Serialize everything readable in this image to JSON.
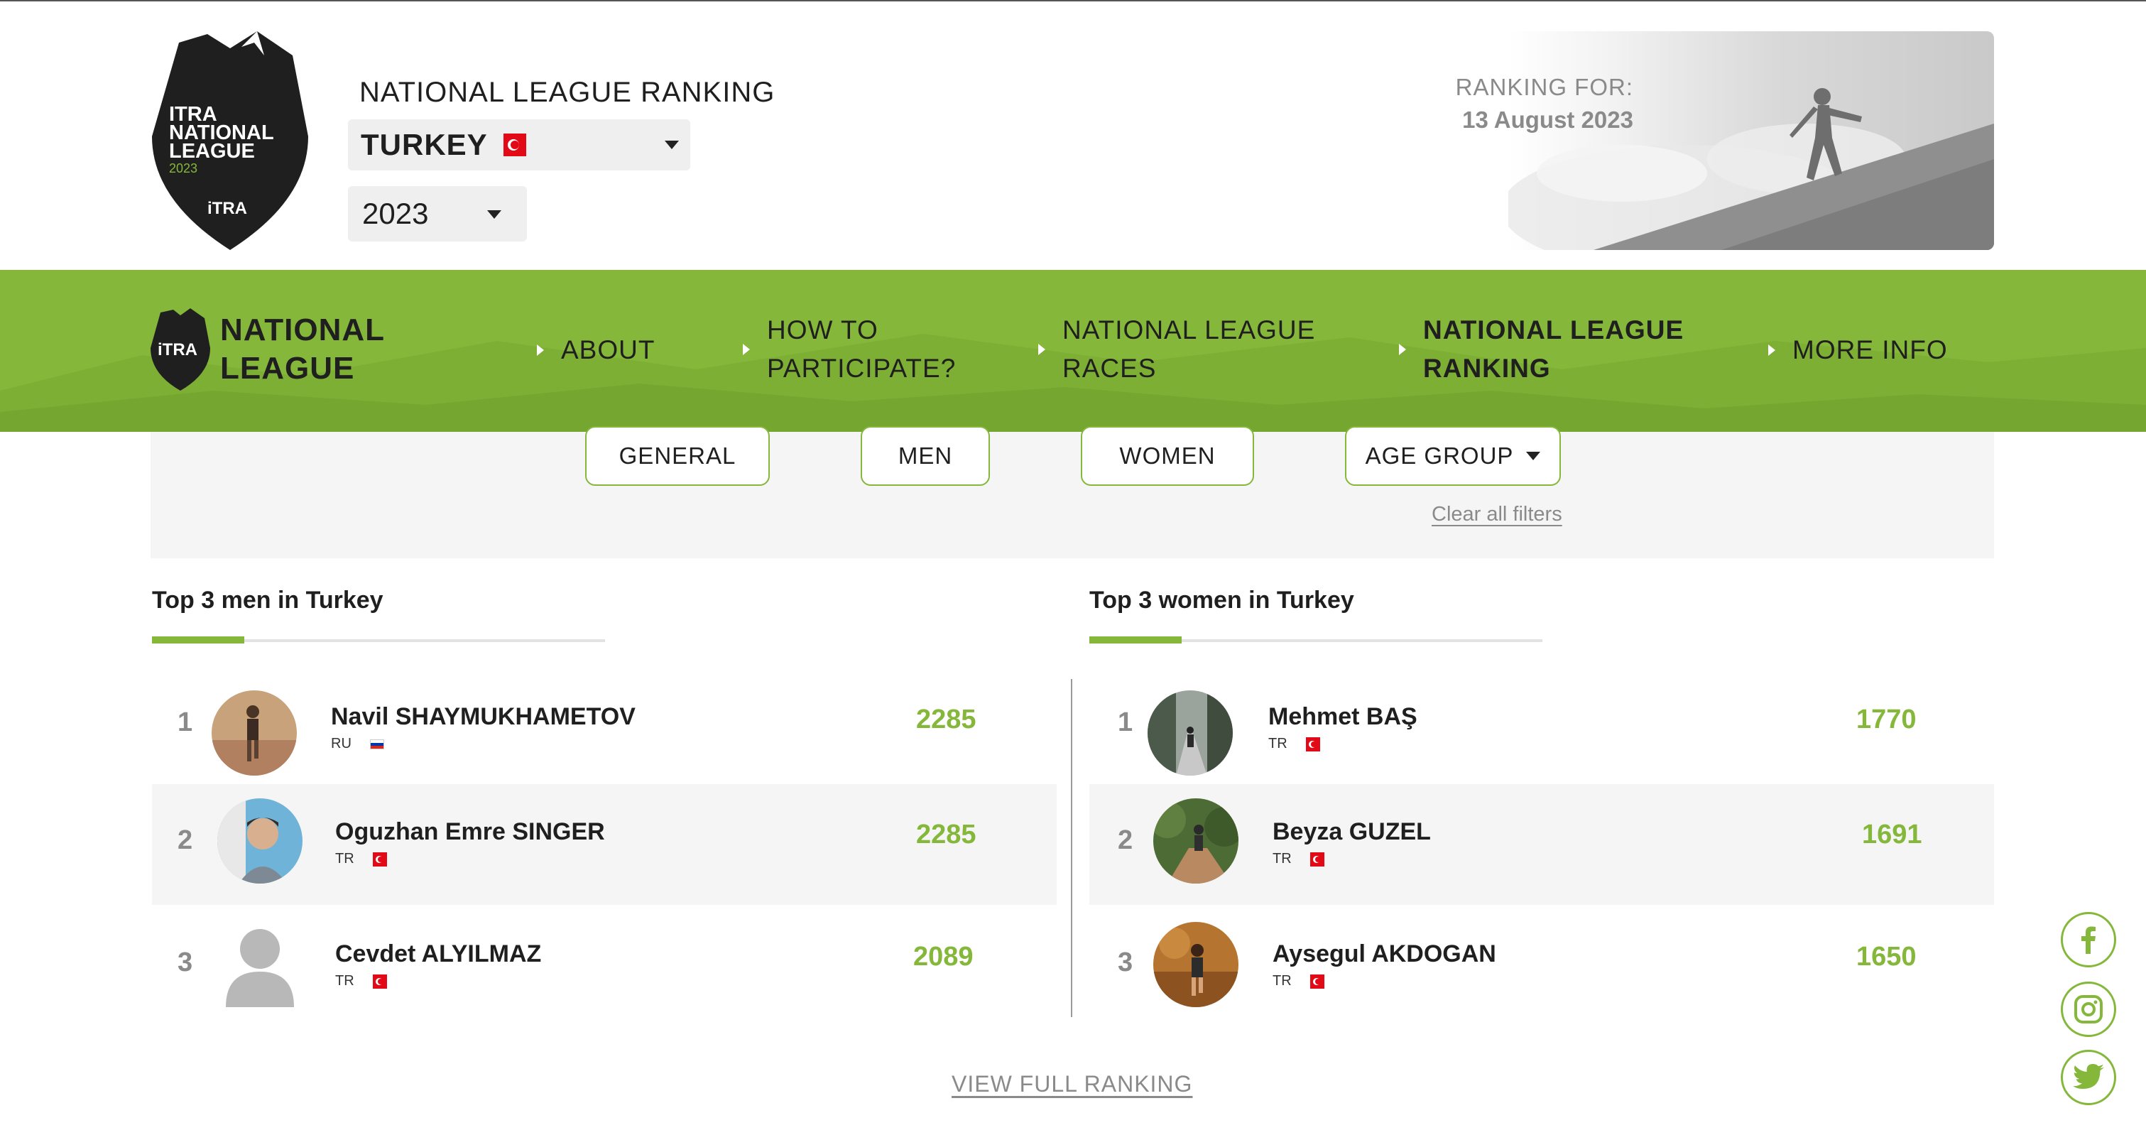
{
  "header": {
    "badge": {
      "line1": "ITRA",
      "line2": "NATIONAL",
      "line3": "LEAGUE",
      "year": "2023",
      "brand": "iTRA"
    },
    "title": "NATIONAL LEAGUE RANKING",
    "country_select": {
      "value": "TURKEY",
      "flag_icon": "turkey-flag-icon"
    },
    "year_select": {
      "value": "2023"
    },
    "ranking_for_label": "RANKING FOR:",
    "ranking_date": "13 August 2023"
  },
  "nav": {
    "logo": {
      "brand": "iTRA",
      "line1": "NATIONAL",
      "line2": "LEAGUE"
    },
    "items": [
      {
        "line1": "ABOUT",
        "line2": ""
      },
      {
        "line1": "HOW TO",
        "line2": "PARTICIPATE?"
      },
      {
        "line1": "NATIONAL LEAGUE",
        "line2": "RACES"
      },
      {
        "line1": "NATIONAL LEAGUE",
        "line2": "RANKING"
      },
      {
        "line1": "MORE INFO",
        "line2": ""
      }
    ],
    "active_index": 3
  },
  "filters": {
    "chips": [
      "GENERAL",
      "MEN",
      "WOMEN",
      "AGE GROUP"
    ],
    "clear_label": "Clear all filters"
  },
  "men": {
    "title": "Top 3 men in Turkey",
    "rows": [
      {
        "rank": "1",
        "name": "Navil SHAYMUKHAMETOV",
        "country": "RU",
        "score": "2285"
      },
      {
        "rank": "2",
        "name": "Oguzhan Emre SINGER",
        "country": "TR",
        "score": "2285"
      },
      {
        "rank": "3",
        "name": "Cevdet ALYILMAZ",
        "country": "TR",
        "score": "2089"
      }
    ]
  },
  "women": {
    "title": "Top 3 women in Turkey",
    "rows": [
      {
        "rank": "1",
        "name": "Mehmet BAŞ",
        "country": "TR",
        "score": "1770"
      },
      {
        "rank": "2",
        "name": "Beyza GUZEL",
        "country": "TR",
        "score": "1691"
      },
      {
        "rank": "3",
        "name": "Aysegul AKDOGAN",
        "country": "TR",
        "score": "1650"
      }
    ]
  },
  "view_full_label": "VIEW FULL RANKING",
  "social": [
    "facebook-icon",
    "instagram-icon",
    "twitter-icon"
  ],
  "colors": {
    "accent": "#84b73a",
    "dark": "#1f1f1f",
    "muted": "#8a8a8a"
  }
}
